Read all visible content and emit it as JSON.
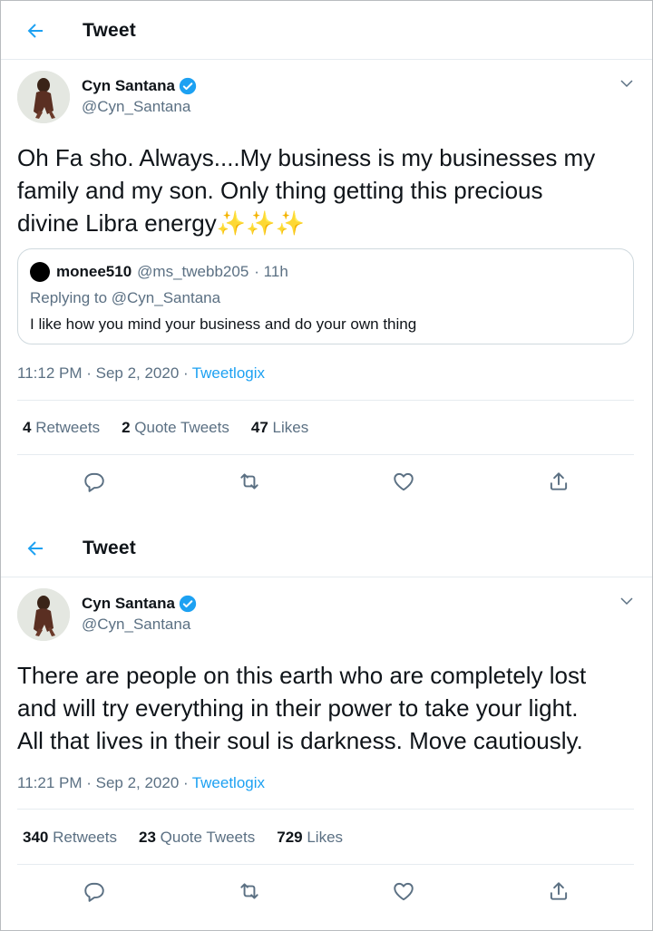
{
  "tweets": [
    {
      "header_title": "Tweet",
      "author_name": "Cyn Santana",
      "author_handle": "@Cyn_Santana",
      "text_line1": "Oh Fa sho. Always....My business is my businesses my",
      "text_line2": "family and my son. Only thing getting this precious",
      "text_line3": "divine Libra energy✨✨✨",
      "quoted": {
        "name": "monee510",
        "handle": "@ms_twebb205",
        "time": "· 11h",
        "replying_to": "Replying to @Cyn_Santana",
        "text": "I like how you mind your business and do your own thing"
      },
      "timestamp": "11:12 PM · Sep 2, 2020 ·",
      "source": "Tweetlogix",
      "retweets_count": "4",
      "retweets_label": "Retweets",
      "quotes_count": "2",
      "quotes_label": "Quote Tweets",
      "likes_count": "47",
      "likes_label": "Likes"
    },
    {
      "header_title": "Tweet",
      "author_name": "Cyn Santana",
      "author_handle": "@Cyn_Santana",
      "text_line1": "There are people on this earth who are completely lost",
      "text_line2": "and will try everything in their power to take your light.",
      "text_line3": "All that lives in their soul is darkness. Move cautiously.",
      "timestamp": "11:21 PM · Sep 2, 2020 ·",
      "source": "Tweetlogix",
      "retweets_count": "340",
      "retweets_label": "Retweets",
      "quotes_count": "23",
      "quotes_label": "Quote Tweets",
      "likes_count": "729",
      "likes_label": "Likes"
    }
  ],
  "colors": {
    "accent": "#1da1f2",
    "muted": "#5b7083",
    "text": "#0f1419",
    "border": "#e6ecf0"
  },
  "icons": [
    "back-arrow-icon",
    "verified-badge-icon",
    "chevron-down-icon",
    "reply-icon",
    "retweet-icon",
    "like-icon",
    "share-icon"
  ]
}
